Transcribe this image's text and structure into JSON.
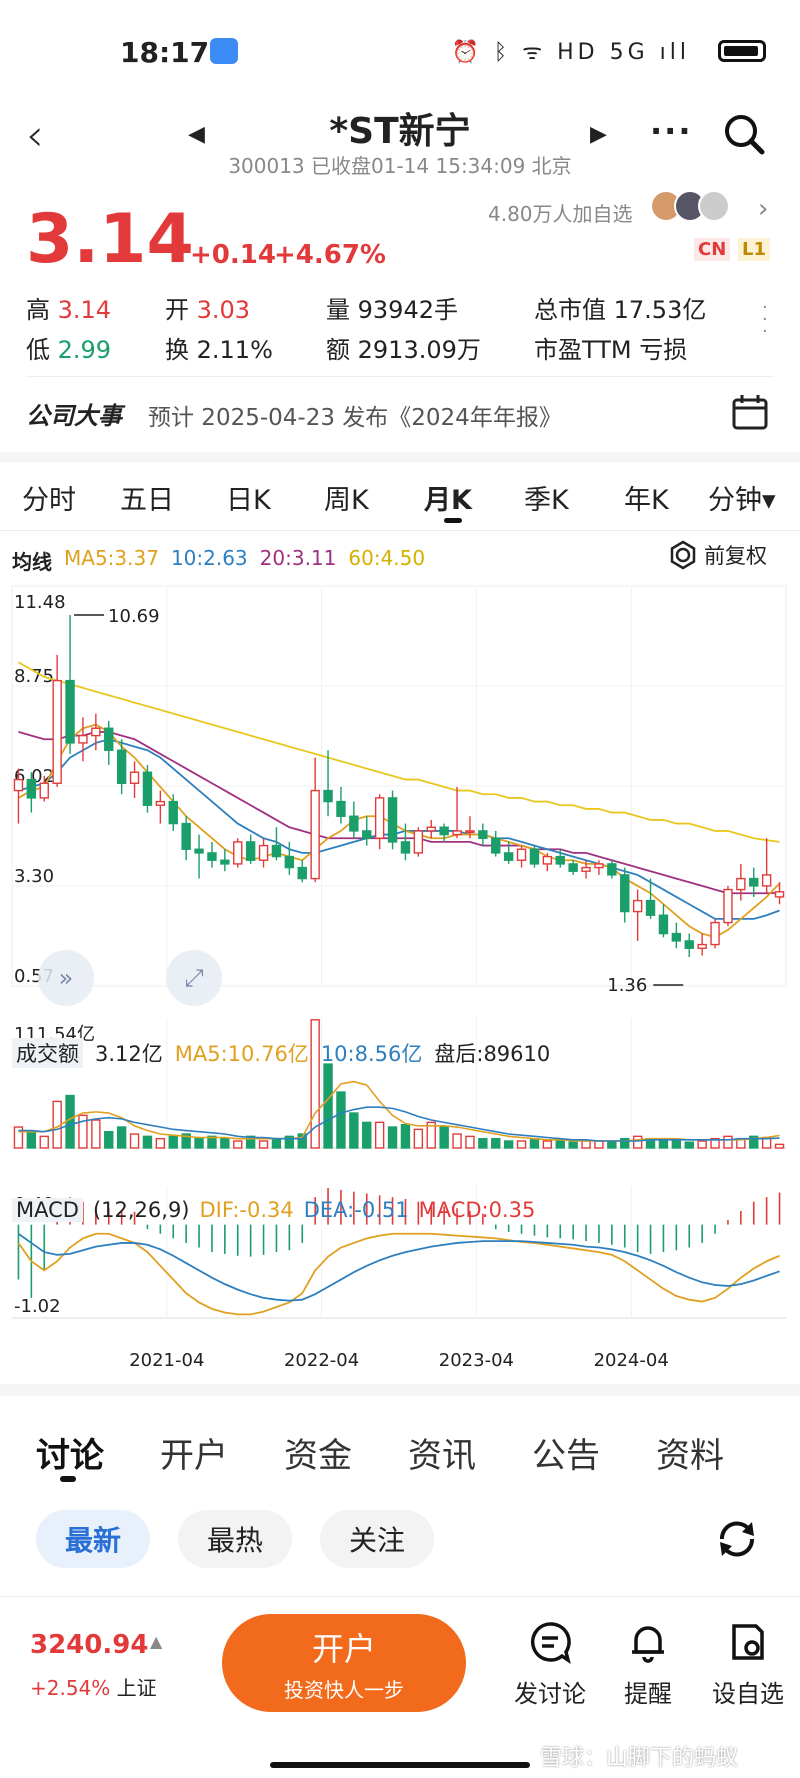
{
  "status": {
    "time": "18:17",
    "icons": "⏰ ᛒ ᯤ HD 5G ıll"
  },
  "header": {
    "title": "*ST新宁",
    "subtitle": "300013 已收盘01-14 15:34:09 北京",
    "followers": "4.80万人加自选",
    "tags": [
      "CN",
      "L1"
    ]
  },
  "quote": {
    "price": "3.14",
    "change": "+0.14",
    "change_pct": "+4.67%",
    "high_label": "高",
    "high": "3.14",
    "low_label": "低",
    "low": "2.99",
    "open_label": "开",
    "open": "3.03",
    "turnover_label": "换",
    "turnover": "2.11%",
    "volume_label": "量",
    "volume": "93942手",
    "amount_label": "额",
    "amount": "2913.09万",
    "mktcap_label": "总市值",
    "mktcap": "17.53亿",
    "pe_label": "市盈TTM",
    "pe": "亏损"
  },
  "event": {
    "label": "公司大事",
    "text": "预计 2025-04-23 发布《2024年年报》"
  },
  "period_tabs": [
    "分时",
    "五日",
    "日K",
    "周K",
    "月K",
    "季K",
    "年K",
    "分钟▾"
  ],
  "active_period": "月K",
  "ma_legend": {
    "label": "均线",
    "ma5": "MA5:3.37",
    "ma10": "10:2.63",
    "ma20": "20:3.11",
    "ma60": "60:4.50",
    "adjust": "前复权"
  },
  "volume_legend": {
    "label": "成交额",
    "value": "3.12亿",
    "ma5": "MA5:10.76亿",
    "ma10": "10:8.56亿",
    "after": "盘后:89610"
  },
  "macd_legend": {
    "label": "MACD",
    "params": "(12,26,9)",
    "dif": "DIF:-0.34",
    "dea": "DEA:-0.51",
    "macd": "MACD:0.35"
  },
  "colors": {
    "up": "#e23a3a",
    "down": "#1a9e6a",
    "ma5": "#e0a020",
    "ma10": "#2d7fbf",
    "ma20": "#a03080",
    "ma60": "#e8c820",
    "accent_orange": "#f26a1b"
  },
  "chart_data": [
    {
      "type": "candlestick",
      "title": "",
      "y_ticks": [
        "11.48",
        "8.75",
        "6.02",
        "3.30",
        "0.57"
      ],
      "ylim": [
        0.57,
        11.48
      ],
      "x_ticks": [
        "2021-04",
        "2022-04",
        "2023-04",
        "2024-04"
      ],
      "annotations": [
        "10.69",
        "1.36"
      ],
      "candles": [
        [
          5.9,
          6.5,
          5.0,
          6.2
        ],
        [
          6.2,
          6.4,
          5.3,
          5.7
        ],
        [
          5.7,
          6.3,
          5.6,
          6.1
        ],
        [
          6.1,
          9.6,
          6.0,
          8.9
        ],
        [
          8.9,
          10.69,
          6.9,
          7.2
        ],
        [
          7.2,
          7.9,
          6.7,
          7.4
        ],
        [
          7.4,
          8.0,
          7.0,
          7.6
        ],
        [
          7.6,
          7.8,
          6.6,
          7.0
        ],
        [
          7.0,
          7.3,
          5.8,
          6.1
        ],
        [
          6.1,
          6.7,
          5.7,
          6.4
        ],
        [
          6.4,
          6.6,
          5.3,
          5.5
        ],
        [
          5.5,
          5.9,
          5.0,
          5.6
        ],
        [
          5.6,
          5.8,
          4.8,
          5.0
        ],
        [
          5.0,
          5.2,
          4.0,
          4.3
        ],
        [
          4.3,
          4.7,
          3.5,
          4.2
        ],
        [
          4.2,
          4.5,
          3.8,
          4.0
        ],
        [
          4.0,
          4.3,
          3.7,
          3.9
        ],
        [
          3.9,
          4.6,
          3.8,
          4.5
        ],
        [
          4.5,
          4.7,
          3.9,
          4.0
        ],
        [
          4.0,
          4.6,
          3.8,
          4.4
        ],
        [
          4.4,
          4.9,
          4.0,
          4.1
        ],
        [
          4.1,
          4.5,
          3.6,
          3.8
        ],
        [
          3.8,
          4.0,
          3.4,
          3.5
        ],
        [
          3.5,
          6.8,
          3.4,
          5.9
        ],
        [
          5.9,
          7.0,
          5.2,
          5.6
        ],
        [
          5.6,
          6.0,
          5.0,
          5.2
        ],
        [
          5.2,
          5.6,
          4.6,
          4.8
        ],
        [
          4.8,
          5.2,
          4.4,
          4.6
        ],
        [
          4.6,
          5.8,
          4.3,
          5.7
        ],
        [
          5.7,
          5.9,
          4.3,
          4.5
        ],
        [
          4.5,
          5.0,
          4.0,
          4.2
        ],
        [
          4.2,
          4.9,
          4.1,
          4.8
        ],
        [
          4.8,
          5.1,
          4.6,
          4.9
        ],
        [
          4.9,
          5.0,
          4.5,
          4.7
        ],
        [
          4.7,
          6.0,
          4.6,
          4.8
        ],
        [
          4.8,
          5.2,
          4.6,
          4.8
        ],
        [
          4.8,
          5.0,
          4.4,
          4.6
        ],
        [
          4.6,
          4.8,
          4.1,
          4.2
        ],
        [
          4.2,
          4.5,
          3.9,
          4.0
        ],
        [
          4.0,
          4.4,
          3.8,
          4.3
        ],
        [
          4.3,
          4.4,
          3.8,
          3.9
        ],
        [
          3.9,
          4.2,
          3.7,
          4.1
        ],
        [
          4.1,
          4.3,
          3.8,
          3.9
        ],
        [
          3.9,
          4.0,
          3.6,
          3.7
        ],
        [
          3.7,
          4.0,
          3.5,
          3.8
        ],
        [
          3.8,
          4.0,
          3.6,
          3.9
        ],
        [
          3.9,
          4.0,
          3.5,
          3.6
        ],
        [
          3.6,
          3.8,
          2.3,
          2.6
        ],
        [
          2.6,
          3.2,
          1.8,
          2.9
        ],
        [
          2.9,
          3.5,
          2.4,
          2.5
        ],
        [
          2.5,
          2.8,
          1.9,
          2.0
        ],
        [
          2.0,
          2.3,
          1.6,
          1.8
        ],
        [
          1.8,
          2.0,
          1.36,
          1.6
        ],
        [
          1.6,
          2.0,
          1.4,
          1.7
        ],
        [
          1.7,
          2.4,
          1.6,
          2.3
        ],
        [
          2.3,
          3.3,
          2.2,
          3.2
        ],
        [
          3.2,
          3.9,
          2.9,
          3.5
        ],
        [
          3.5,
          3.8,
          3.0,
          3.3
        ],
        [
          3.3,
          4.6,
          3.1,
          3.6
        ],
        [
          3.0,
          3.4,
          2.8,
          3.14
        ]
      ],
      "ma5": [
        5.7,
        5.9,
        6.0,
        6.7,
        7.3,
        7.6,
        7.7,
        7.5,
        7.1,
        6.8,
        6.4,
        6.0,
        5.6,
        5.2,
        4.9,
        4.6,
        4.3,
        4.1,
        4.0,
        4.1,
        4.2,
        4.1,
        4.0,
        4.3,
        4.6,
        4.8,
        5.1,
        5.2,
        5.2,
        5.0,
        4.8,
        4.7,
        4.6,
        4.6,
        4.7,
        4.7,
        4.7,
        4.6,
        4.5,
        4.4,
        4.3,
        4.1,
        4.0,
        4.0,
        3.9,
        3.9,
        3.8,
        3.5,
        3.3,
        3.1,
        2.8,
        2.5,
        2.2,
        2.0,
        1.9,
        2.1,
        2.4,
        2.7,
        3.0,
        3.37
      ],
      "ma10": [
        5.9,
        6.0,
        6.1,
        6.4,
        6.8,
        7.0,
        7.2,
        7.3,
        7.2,
        7.1,
        7.0,
        6.8,
        6.5,
        6.2,
        5.9,
        5.6,
        5.3,
        5.0,
        4.8,
        4.6,
        4.5,
        4.3,
        4.2,
        4.2,
        4.3,
        4.4,
        4.5,
        4.6,
        4.7,
        4.7,
        4.8,
        4.8,
        4.8,
        4.8,
        4.8,
        4.7,
        4.7,
        4.6,
        4.6,
        4.5,
        4.4,
        4.3,
        4.2,
        4.1,
        4.0,
        3.9,
        3.8,
        3.7,
        3.6,
        3.4,
        3.2,
        3.0,
        2.8,
        2.6,
        2.4,
        2.4,
        2.4,
        2.4,
        2.5,
        2.63
      ],
      "ma20": [
        7.5,
        7.4,
        7.3,
        7.3,
        7.4,
        7.4,
        7.5,
        7.5,
        7.4,
        7.3,
        7.1,
        6.9,
        6.7,
        6.5,
        6.3,
        6.1,
        5.9,
        5.7,
        5.5,
        5.3,
        5.1,
        4.9,
        4.8,
        4.7,
        4.6,
        4.6,
        4.6,
        4.6,
        4.6,
        4.6,
        4.6,
        4.6,
        4.5,
        4.5,
        4.5,
        4.5,
        4.4,
        4.4,
        4.4,
        4.4,
        4.3,
        4.3,
        4.3,
        4.2,
        4.2,
        4.1,
        4.0,
        3.9,
        3.8,
        3.7,
        3.6,
        3.5,
        3.4,
        3.3,
        3.2,
        3.1,
        3.1,
        3.1,
        3.1,
        3.11
      ],
      "ma60": [
        9.4,
        9.2,
        9.0,
        8.9,
        8.8,
        8.7,
        8.6,
        8.5,
        8.4,
        8.3,
        8.2,
        8.1,
        8.0,
        7.9,
        7.8,
        7.7,
        7.6,
        7.5,
        7.4,
        7.3,
        7.2,
        7.1,
        7.0,
        6.9,
        6.8,
        6.7,
        6.6,
        6.5,
        6.4,
        6.3,
        6.2,
        6.2,
        6.1,
        6.0,
        5.9,
        5.9,
        5.8,
        5.8,
        5.7,
        5.7,
        5.6,
        5.6,
        5.5,
        5.5,
        5.4,
        5.4,
        5.3,
        5.3,
        5.2,
        5.1,
        5.1,
        5.0,
        5.0,
        4.9,
        4.8,
        4.8,
        4.7,
        4.6,
        4.55,
        4.5
      ]
    },
    {
      "type": "bar",
      "title": "成交额",
      "ylim": [
        0,
        111.54
      ],
      "y_ticks": [
        "111.54亿"
      ],
      "values": [
        18,
        14,
        10,
        40,
        45,
        28,
        24,
        14,
        18,
        12,
        10,
        8,
        10,
        12,
        8,
        10,
        8,
        6,
        10,
        6,
        8,
        10,
        12,
        110,
        72,
        48,
        30,
        22,
        22,
        18,
        20,
        16,
        22,
        18,
        12,
        10,
        8,
        8,
        6,
        6,
        8,
        6,
        6,
        5,
        6,
        6,
        6,
        8,
        10,
        8,
        6,
        6,
        5,
        6,
        8,
        10,
        8,
        10,
        9,
        3.12
      ],
      "ma5": [
        14,
        14,
        14,
        18,
        25,
        30,
        31,
        30,
        26,
        19,
        15,
        12,
        11,
        10,
        9,
        9,
        9,
        8,
        8,
        8,
        8,
        8,
        9,
        30,
        42,
        55,
        57,
        54,
        40,
        28,
        21,
        19,
        19,
        19,
        18,
        16,
        14,
        12,
        10,
        9,
        8,
        7,
        7,
        6,
        6,
        6,
        6,
        6,
        7,
        8,
        8,
        8,
        7,
        7,
        7,
        7,
        7,
        8,
        9,
        10.76
      ],
      "ma10": [
        15,
        15,
        14,
        16,
        20,
        23,
        25,
        26,
        25,
        22,
        20,
        18,
        16,
        15,
        14,
        13,
        12,
        10,
        9,
        9,
        8,
        8,
        8,
        18,
        24,
        30,
        33,
        35,
        35,
        34,
        31,
        27,
        24,
        22,
        20,
        18,
        16,
        14,
        12,
        11,
        10,
        9,
        8,
        7,
        7,
        6,
        6,
        6,
        6,
        7,
        7,
        7,
        7,
        7,
        7,
        7,
        8,
        8,
        8,
        8.56
      ],
      "x_ticks": [
        "2021-04",
        "2022-04",
        "2023-04",
        "2024-04"
      ]
    },
    {
      "type": "bar",
      "title": "MACD",
      "ylim": [
        -1.02,
        0.4
      ],
      "y_ticks": [
        "0.40",
        "-1.02"
      ],
      "values": [
        -0.6,
        -0.8,
        -0.5,
        0.2,
        0.3,
        0.25,
        0.2,
        0.18,
        0.16,
        0.14,
        -0.05,
        -0.1,
        -0.15,
        -0.2,
        -0.25,
        -0.3,
        -0.32,
        -0.34,
        -0.35,
        -0.33,
        -0.3,
        -0.28,
        -0.2,
        0.3,
        0.4,
        0.38,
        0.36,
        0.34,
        0.32,
        0.3,
        0.28,
        0.25,
        0.22,
        0.2,
        0.18,
        0.15,
        0.12,
        -0.05,
        -0.08,
        -0.1,
        -0.12,
        -0.14,
        -0.15,
        -0.16,
        -0.18,
        -0.2,
        -0.22,
        -0.25,
        -0.3,
        -0.32,
        -0.3,
        -0.28,
        -0.25,
        -0.2,
        -0.1,
        0.05,
        0.15,
        0.25,
        0.3,
        0.35
      ],
      "dif": [
        -0.2,
        -0.4,
        -0.5,
        -0.4,
        -0.25,
        -0.15,
        -0.1,
        -0.1,
        -0.15,
        -0.2,
        -0.3,
        -0.45,
        -0.6,
        -0.75,
        -0.85,
        -0.92,
        -0.96,
        -0.98,
        -0.98,
        -0.95,
        -0.9,
        -0.85,
        -0.75,
        -0.5,
        -0.35,
        -0.25,
        -0.2,
        -0.15,
        -0.12,
        -0.1,
        -0.1,
        -0.1,
        -0.1,
        -0.11,
        -0.12,
        -0.13,
        -0.14,
        -0.15,
        -0.17,
        -0.19,
        -0.2,
        -0.22,
        -0.24,
        -0.26,
        -0.28,
        -0.3,
        -0.33,
        -0.4,
        -0.5,
        -0.6,
        -0.7,
        -0.78,
        -0.82,
        -0.84,
        -0.8,
        -0.7,
        -0.58,
        -0.48,
        -0.4,
        -0.34
      ],
      "dea": [
        -0.1,
        -0.2,
        -0.3,
        -0.33,
        -0.32,
        -0.28,
        -0.24,
        -0.22,
        -0.2,
        -0.2,
        -0.22,
        -0.27,
        -0.34,
        -0.42,
        -0.5,
        -0.58,
        -0.65,
        -0.71,
        -0.76,
        -0.8,
        -0.82,
        -0.83,
        -0.82,
        -0.76,
        -0.68,
        -0.6,
        -0.52,
        -0.45,
        -0.39,
        -0.34,
        -0.3,
        -0.27,
        -0.24,
        -0.22,
        -0.2,
        -0.19,
        -0.18,
        -0.18,
        -0.18,
        -0.18,
        -0.19,
        -0.2,
        -0.21,
        -0.22,
        -0.24,
        -0.25,
        -0.27,
        -0.3,
        -0.34,
        -0.39,
        -0.45,
        -0.52,
        -0.58,
        -0.63,
        -0.66,
        -0.67,
        -0.65,
        -0.61,
        -0.56,
        -0.51
      ],
      "x_ticks": [
        "2021-04",
        "2022-04",
        "2023-04",
        "2024-04"
      ]
    }
  ],
  "discussion_tabs": [
    "讨论",
    "开户",
    "资金",
    "资讯",
    "公告",
    "资料"
  ],
  "active_discussion_tab": "讨论",
  "sort_pills": [
    "最新",
    "最热",
    "关注"
  ],
  "active_sort_pill": "最新",
  "index": {
    "value": "3240.94",
    "change": "+2.54%",
    "name": "上证"
  },
  "open_account": {
    "label": "开户",
    "sub": "投资快人一步"
  },
  "bottom_actions": [
    {
      "label": "发讨论",
      "icon": "chat-icon"
    },
    {
      "label": "提醒",
      "icon": "bell-icon"
    },
    {
      "label": "设自选",
      "icon": "star-settings-icon"
    }
  ],
  "watermark": "雪球：山脚下的蚂蚁"
}
